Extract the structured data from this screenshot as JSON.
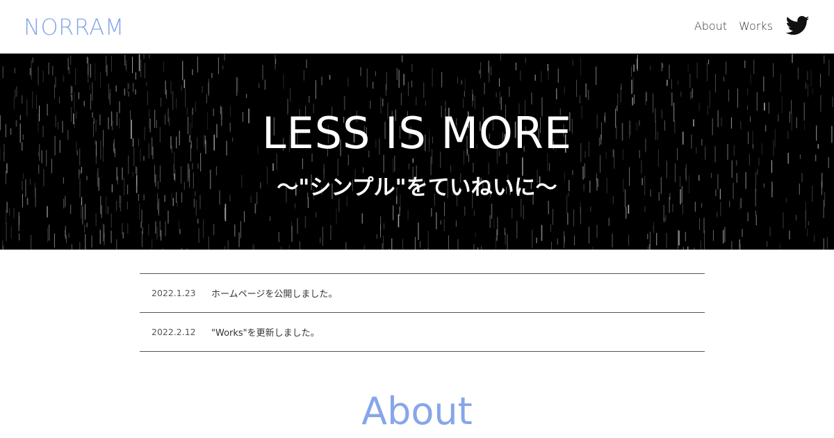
{
  "header": {
    "logo": "NORRAM",
    "nav": [
      {
        "label": "About"
      },
      {
        "label": "Works"
      }
    ],
    "social_icon": "twitter-icon"
  },
  "hero": {
    "title": "LESS IS MORE",
    "subtitle": "〜\"シンプル\"をていねいに〜"
  },
  "news": [
    {
      "date": "2022.1.23",
      "text": "ホームページを公開しました。"
    },
    {
      "date": "2022.2.12",
      "text": "\"Works\"を更新しました。"
    }
  ],
  "about": {
    "heading": "About"
  },
  "colors": {
    "accent": "#86a6e8",
    "hero_bg": "#000000",
    "text": "#333333"
  }
}
